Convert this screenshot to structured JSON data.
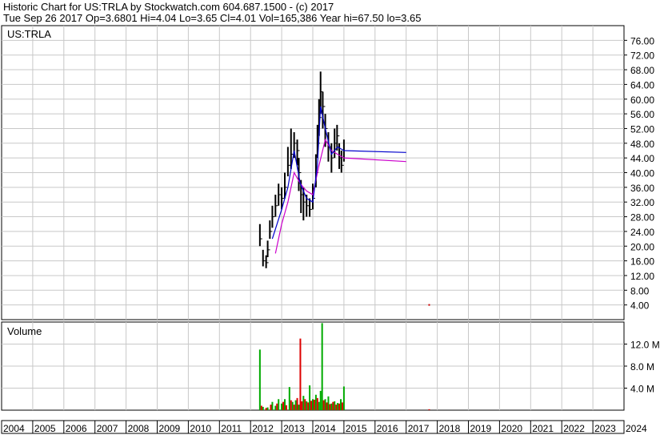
{
  "header": {
    "line1": "Historic Chart for US:TRLA by Stockwatch.com 604.687.1500 - (c) 2017",
    "line2": "Tue Sep 26 2017   Op=3.6801   Hi=4.04   Lo=3.65   Cl=4.01   Vol=165,386   Year hi=67.50   lo=3.65"
  },
  "colors": {
    "grid": "#c8c8c8",
    "candle": "#000000",
    "ma_short": "#0000cc",
    "ma_long": "#cc00cc",
    "vol_up": "#00aa00",
    "vol_down": "#dd0000",
    "last_mark": "#cc0000"
  },
  "chart_data": [
    {
      "type": "candlestick",
      "label": "US:TRLA",
      "ylim": [
        0,
        80
      ],
      "y_ticks": [
        "4.00",
        "8.00",
        "12.00",
        "16.00",
        "20.00",
        "24.00",
        "28.00",
        "32.00",
        "36.00",
        "40.00",
        "44.00",
        "48.00",
        "52.00",
        "56.00",
        "60.00",
        "64.00",
        "68.00",
        "72.00",
        "76.00"
      ],
      "y_tick_values": [
        4,
        8,
        12,
        16,
        20,
        24,
        28,
        32,
        36,
        40,
        44,
        48,
        52,
        56,
        60,
        64,
        68,
        72,
        76
      ],
      "xlim": [
        2004,
        2024
      ],
      "x_ticks": [
        "2004",
        "2005",
        "2006",
        "2007",
        "2008",
        "2009",
        "2010",
        "2011",
        "2012",
        "2013",
        "2014",
        "2015",
        "2016",
        "2017",
        "2018",
        "2019",
        "2020",
        "2021",
        "2022",
        "2023",
        "2024"
      ],
      "series": [
        {
          "kind": "close",
          "x": [
            2012.3,
            2012.4,
            2012.5,
            2012.55,
            2012.62,
            2012.7,
            2012.8,
            2012.9,
            2013.0,
            2013.1,
            2013.2,
            2013.3,
            2013.4,
            2013.5,
            2013.55,
            2013.62,
            2013.7,
            2013.8,
            2013.9,
            2014.0,
            2014.1,
            2014.15,
            2014.2,
            2014.25,
            2014.32,
            2014.4,
            2014.5,
            2014.6,
            2014.7,
            2014.78,
            2014.85,
            2014.92,
            2015.0
          ],
          "y": [
            22.0,
            16.0,
            15.5,
            19.0,
            24.0,
            28.0,
            31.0,
            34.0,
            33.0,
            36.0,
            42.0,
            45.0,
            48.0,
            46.0,
            40.0,
            34.0,
            32.0,
            31.0,
            30.0,
            33.0,
            40.0,
            48.0,
            55.0,
            62.0,
            58.0,
            52.0,
            47.0,
            44.0,
            48.0,
            50.0,
            44.0,
            42.0,
            46.0
          ]
        },
        {
          "kind": "high",
          "x": [
            2012.3,
            2012.4,
            2012.5,
            2012.55,
            2012.62,
            2012.7,
            2012.8,
            2012.9,
            2013.0,
            2013.1,
            2013.2,
            2013.3,
            2013.4,
            2013.5,
            2013.55,
            2013.62,
            2013.7,
            2013.8,
            2013.9,
            2014.0,
            2014.1,
            2014.15,
            2014.2,
            2014.25,
            2014.32,
            2014.4,
            2014.5,
            2014.6,
            2014.7,
            2014.78,
            2014.85,
            2014.92,
            2015.0
          ],
          "y": [
            26.0,
            19.0,
            17.5,
            21.5,
            27.0,
            31.0,
            34.0,
            37.0,
            36.0,
            40.0,
            47.0,
            52.0,
            51.0,
            49.0,
            44.0,
            38.0,
            36.0,
            34.0,
            33.0,
            37.0,
            45.0,
            53.0,
            60.0,
            67.5,
            62.0,
            56.0,
            51.0,
            48.0,
            52.0,
            53.0,
            48.0,
            46.0,
            49.0
          ]
        },
        {
          "kind": "low",
          "x": [
            2012.3,
            2012.4,
            2012.5,
            2012.55,
            2012.62,
            2012.7,
            2012.8,
            2012.9,
            2013.0,
            2013.1,
            2013.2,
            2013.3,
            2013.4,
            2013.5,
            2013.55,
            2013.62,
            2013.7,
            2013.8,
            2013.9,
            2014.0,
            2014.1,
            2014.15,
            2014.2,
            2014.25,
            2014.32,
            2014.4,
            2014.5,
            2014.6,
            2014.7,
            2014.78,
            2014.85,
            2014.92,
            2015.0
          ],
          "y": [
            20.0,
            14.5,
            14.0,
            17.0,
            22.0,
            25.0,
            28.0,
            31.0,
            30.0,
            33.0,
            39.0,
            41.0,
            44.0,
            42.0,
            35.0,
            29.0,
            27.0,
            28.0,
            28.0,
            30.0,
            36.0,
            44.0,
            50.0,
            56.0,
            52.0,
            47.0,
            43.0,
            40.0,
            44.0,
            46.0,
            41.0,
            40.0,
            43.0
          ]
        },
        {
          "kind": "moving-average-short",
          "x": [
            2012.7,
            2013.0,
            2013.2,
            2013.4,
            2013.6,
            2013.8,
            2014.0,
            2014.15,
            2014.25,
            2014.4,
            2014.6,
            2014.8,
            2015.0,
            2017.0
          ],
          "y": [
            22.0,
            30.0,
            36.0,
            46.0,
            37.0,
            33.0,
            32.0,
            42.0,
            58.0,
            52.0,
            45.0,
            47.0,
            46.0,
            45.5
          ]
        },
        {
          "kind": "moving-average-long",
          "x": [
            2012.8,
            2013.0,
            2013.2,
            2013.4,
            2013.6,
            2013.8,
            2014.0,
            2014.2,
            2014.4,
            2014.6,
            2014.8,
            2015.0,
            2017.0
          ],
          "y": [
            18.0,
            26.0,
            32.0,
            40.0,
            37.0,
            35.0,
            34.0,
            42.0,
            49.0,
            46.0,
            45.0,
            44.0,
            43.0
          ]
        },
        {
          "kind": "last-close",
          "x": [
            2017.74
          ],
          "y": [
            4.01
          ]
        }
      ]
    },
    {
      "type": "bar",
      "label": "Volume",
      "ylim": [
        0,
        16
      ],
      "y_ticks": [
        "4.0 M",
        "8.0 M",
        "12.0 M"
      ],
      "y_tick_values": [
        4,
        8,
        12
      ],
      "xlim": [
        2004,
        2024
      ],
      "series": [
        {
          "kind": "volume-up",
          "x": [
            2012.3,
            2012.4,
            2012.55,
            2012.7,
            2012.8,
            2012.9,
            2013.0,
            2013.1,
            2013.25,
            2013.35,
            2013.45,
            2013.55,
            2013.7,
            2013.8,
            2013.9,
            2014.0,
            2014.1,
            2014.2,
            2014.25,
            2014.3,
            2014.4,
            2014.5,
            2014.6,
            2014.7,
            2014.8,
            2014.9,
            2015.0
          ],
          "y": [
            11.0,
            0.6,
            0.5,
            1.5,
            0.8,
            2.0,
            1.2,
            2.0,
            4.2,
            1.5,
            1.8,
            1.0,
            2.6,
            1.6,
            4.5,
            2.0,
            2.8,
            1.5,
            3.5,
            15.8,
            2.0,
            2.5,
            1.2,
            1.6,
            1.3,
            2.0,
            4.3
          ]
        },
        {
          "kind": "volume-down",
          "x": [
            2012.35,
            2012.5,
            2012.65,
            2012.85,
            2013.05,
            2013.15,
            2013.3,
            2013.4,
            2013.5,
            2013.6,
            2013.65,
            2013.75,
            2013.85,
            2013.95,
            2014.05,
            2014.15,
            2014.35,
            2014.45,
            2014.55,
            2014.65,
            2014.75,
            2014.85,
            2014.95,
            2017.74
          ],
          "y": [
            0.8,
            0.4,
            1.0,
            1.2,
            1.5,
            0.9,
            1.8,
            1.0,
            2.2,
            13.0,
            1.6,
            2.0,
            1.4,
            1.7,
            1.9,
            2.2,
            1.8,
            1.4,
            1.1,
            1.5,
            1.0,
            1.2,
            1.4,
            0.17
          ]
        }
      ]
    }
  ]
}
